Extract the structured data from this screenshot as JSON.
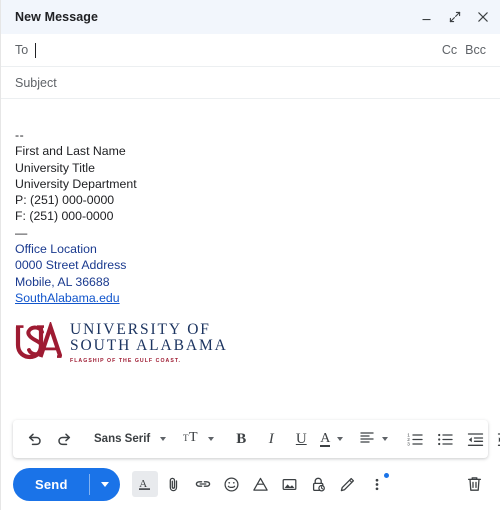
{
  "window": {
    "title": "New Message",
    "controls": [
      {
        "name": "minimize",
        "icon": "minimize-icon"
      },
      {
        "name": "expand",
        "icon": "expand-icon"
      },
      {
        "name": "close",
        "icon": "close-icon"
      }
    ]
  },
  "fields": {
    "to_label": "To",
    "to_value": "",
    "cc_label": "Cc",
    "bcc_label": "Bcc",
    "subject_placeholder": "Subject",
    "subject_value": ""
  },
  "body": {
    "separator": "--",
    "signature": [
      "First and Last Name",
      "University Title",
      "University Department",
      "P: (251) 000-0000",
      "F: (251) 000-0000"
    ],
    "divider": "—",
    "address": [
      "Office Location",
      "0000 Street Address",
      "Mobile, AL 36688"
    ],
    "link_text": "SouthAlabama.edu"
  },
  "logo": {
    "monogram": "USA",
    "line1": "UNIVERSITY OF",
    "line2": "SOUTH ALABAMA",
    "tagline": "FLAGSHIP OF THE GULF COAST.",
    "mark_color": "#9E1B32",
    "text_color": "#1C3460"
  },
  "format_toolbar": {
    "undo": "undo-icon",
    "redo": "redo-icon",
    "font_name": "Sans Serif",
    "size": "text-size-icon",
    "bold": "B",
    "italic": "I",
    "underline": "U",
    "text_color": "A",
    "align": "align-left-icon",
    "numbered_list": "numbered-list-icon",
    "bulleted_list": "bulleted-list-icon",
    "indent_less": "indent-less-icon",
    "indent_more": "indent-more-icon",
    "more": "more-formatting-icon"
  },
  "bottom_bar": {
    "send_label": "Send",
    "send_options": "send-options-icon",
    "icons": [
      {
        "name": "formatting-options",
        "icon": "format-a-icon",
        "active": true
      },
      {
        "name": "attach-files",
        "icon": "paperclip-icon",
        "active": false
      },
      {
        "name": "insert-link",
        "icon": "link-icon",
        "active": false
      },
      {
        "name": "insert-emoji",
        "icon": "emoji-icon",
        "active": false
      },
      {
        "name": "insert-drive-file",
        "icon": "google-drive-icon",
        "active": false
      },
      {
        "name": "insert-photo",
        "icon": "image-icon",
        "active": false
      },
      {
        "name": "confidential-mode",
        "icon": "lock-clock-icon",
        "active": false
      },
      {
        "name": "insert-signature",
        "icon": "pen-icon",
        "active": false
      },
      {
        "name": "more-options",
        "icon": "more-vertical-icon",
        "active": false,
        "badge": true
      }
    ],
    "discard": "trash-icon",
    "accent_color": "#1A73E8"
  }
}
